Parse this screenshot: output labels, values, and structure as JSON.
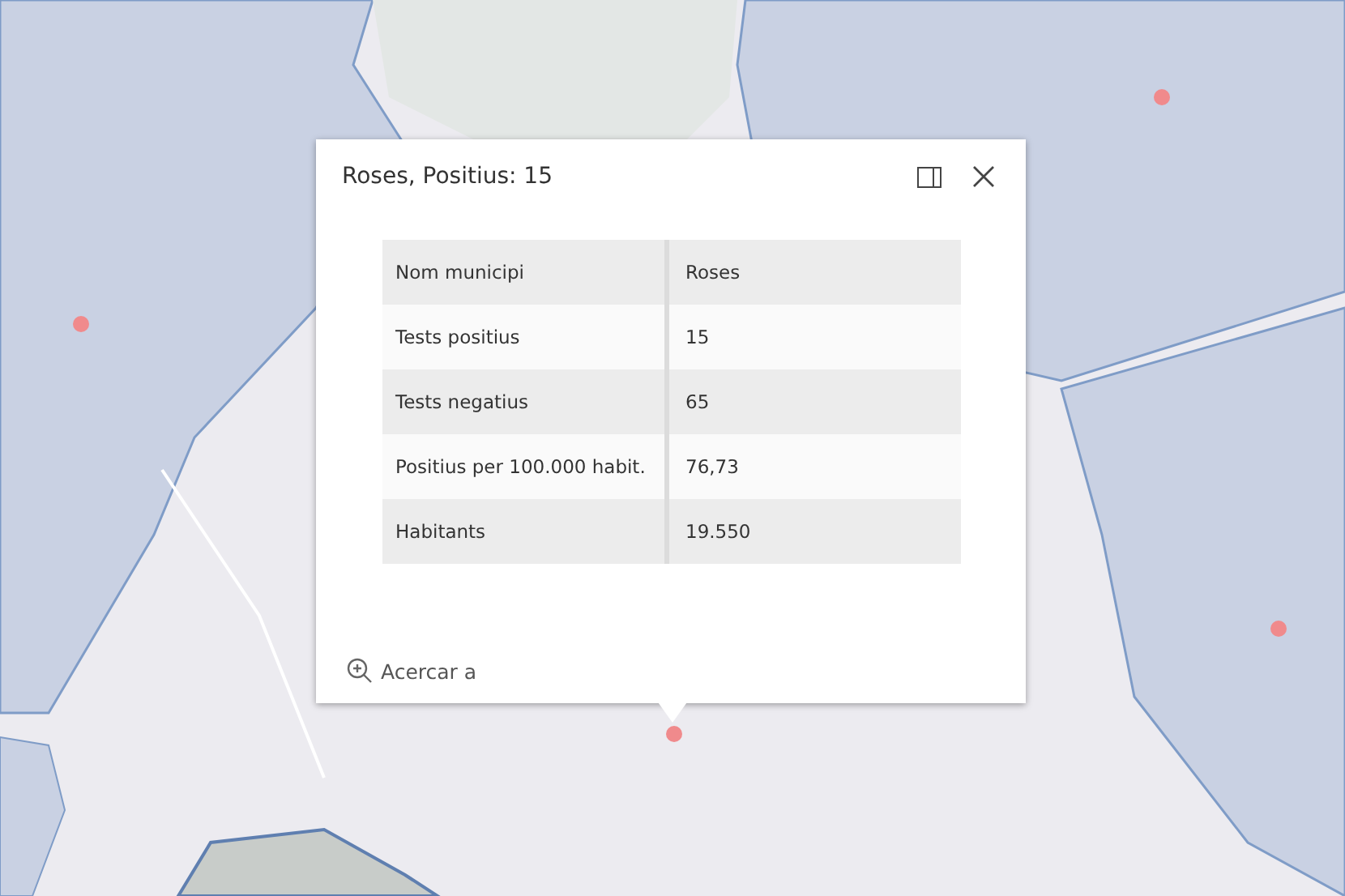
{
  "popup": {
    "title": "Roses, Positius: 15",
    "rows": [
      {
        "field": "Nom municipi",
        "value": "Roses"
      },
      {
        "field": "Tests positius",
        "value": "15"
      },
      {
        "field": "Tests negatius",
        "value": "65"
      },
      {
        "field": "Positius per 100.000 habit.",
        "value": "76,73"
      },
      {
        "field": "Habitants",
        "value": "19.550"
      }
    ],
    "action": "Acercar a"
  }
}
